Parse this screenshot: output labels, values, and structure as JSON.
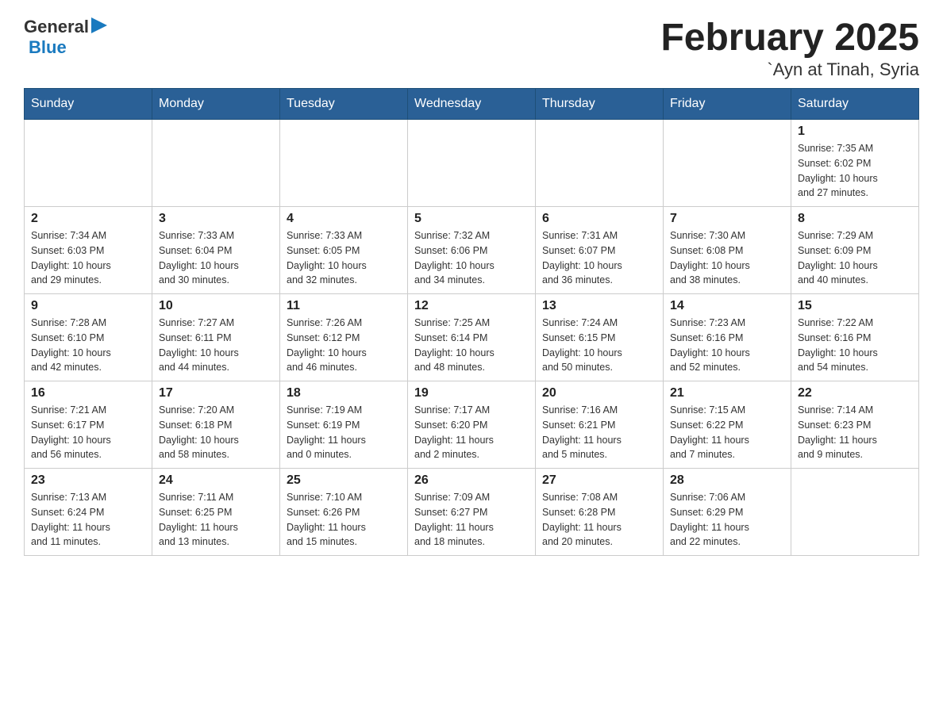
{
  "header": {
    "logo_general": "General",
    "logo_blue": "Blue",
    "month_title": "February 2025",
    "location": "`Ayn at Tinah, Syria"
  },
  "days_of_week": [
    "Sunday",
    "Monday",
    "Tuesday",
    "Wednesday",
    "Thursday",
    "Friday",
    "Saturday"
  ],
  "weeks": [
    {
      "days": [
        {
          "number": "",
          "info": ""
        },
        {
          "number": "",
          "info": ""
        },
        {
          "number": "",
          "info": ""
        },
        {
          "number": "",
          "info": ""
        },
        {
          "number": "",
          "info": ""
        },
        {
          "number": "",
          "info": ""
        },
        {
          "number": "1",
          "info": "Sunrise: 7:35 AM\nSunset: 6:02 PM\nDaylight: 10 hours\nand 27 minutes."
        }
      ]
    },
    {
      "days": [
        {
          "number": "2",
          "info": "Sunrise: 7:34 AM\nSunset: 6:03 PM\nDaylight: 10 hours\nand 29 minutes."
        },
        {
          "number": "3",
          "info": "Sunrise: 7:33 AM\nSunset: 6:04 PM\nDaylight: 10 hours\nand 30 minutes."
        },
        {
          "number": "4",
          "info": "Sunrise: 7:33 AM\nSunset: 6:05 PM\nDaylight: 10 hours\nand 32 minutes."
        },
        {
          "number": "5",
          "info": "Sunrise: 7:32 AM\nSunset: 6:06 PM\nDaylight: 10 hours\nand 34 minutes."
        },
        {
          "number": "6",
          "info": "Sunrise: 7:31 AM\nSunset: 6:07 PM\nDaylight: 10 hours\nand 36 minutes."
        },
        {
          "number": "7",
          "info": "Sunrise: 7:30 AM\nSunset: 6:08 PM\nDaylight: 10 hours\nand 38 minutes."
        },
        {
          "number": "8",
          "info": "Sunrise: 7:29 AM\nSunset: 6:09 PM\nDaylight: 10 hours\nand 40 minutes."
        }
      ]
    },
    {
      "days": [
        {
          "number": "9",
          "info": "Sunrise: 7:28 AM\nSunset: 6:10 PM\nDaylight: 10 hours\nand 42 minutes."
        },
        {
          "number": "10",
          "info": "Sunrise: 7:27 AM\nSunset: 6:11 PM\nDaylight: 10 hours\nand 44 minutes."
        },
        {
          "number": "11",
          "info": "Sunrise: 7:26 AM\nSunset: 6:12 PM\nDaylight: 10 hours\nand 46 minutes."
        },
        {
          "number": "12",
          "info": "Sunrise: 7:25 AM\nSunset: 6:14 PM\nDaylight: 10 hours\nand 48 minutes."
        },
        {
          "number": "13",
          "info": "Sunrise: 7:24 AM\nSunset: 6:15 PM\nDaylight: 10 hours\nand 50 minutes."
        },
        {
          "number": "14",
          "info": "Sunrise: 7:23 AM\nSunset: 6:16 PM\nDaylight: 10 hours\nand 52 minutes."
        },
        {
          "number": "15",
          "info": "Sunrise: 7:22 AM\nSunset: 6:16 PM\nDaylight: 10 hours\nand 54 minutes."
        }
      ]
    },
    {
      "days": [
        {
          "number": "16",
          "info": "Sunrise: 7:21 AM\nSunset: 6:17 PM\nDaylight: 10 hours\nand 56 minutes."
        },
        {
          "number": "17",
          "info": "Sunrise: 7:20 AM\nSunset: 6:18 PM\nDaylight: 10 hours\nand 58 minutes."
        },
        {
          "number": "18",
          "info": "Sunrise: 7:19 AM\nSunset: 6:19 PM\nDaylight: 11 hours\nand 0 minutes."
        },
        {
          "number": "19",
          "info": "Sunrise: 7:17 AM\nSunset: 6:20 PM\nDaylight: 11 hours\nand 2 minutes."
        },
        {
          "number": "20",
          "info": "Sunrise: 7:16 AM\nSunset: 6:21 PM\nDaylight: 11 hours\nand 5 minutes."
        },
        {
          "number": "21",
          "info": "Sunrise: 7:15 AM\nSunset: 6:22 PM\nDaylight: 11 hours\nand 7 minutes."
        },
        {
          "number": "22",
          "info": "Sunrise: 7:14 AM\nSunset: 6:23 PM\nDaylight: 11 hours\nand 9 minutes."
        }
      ]
    },
    {
      "days": [
        {
          "number": "23",
          "info": "Sunrise: 7:13 AM\nSunset: 6:24 PM\nDaylight: 11 hours\nand 11 minutes."
        },
        {
          "number": "24",
          "info": "Sunrise: 7:11 AM\nSunset: 6:25 PM\nDaylight: 11 hours\nand 13 minutes."
        },
        {
          "number": "25",
          "info": "Sunrise: 7:10 AM\nSunset: 6:26 PM\nDaylight: 11 hours\nand 15 minutes."
        },
        {
          "number": "26",
          "info": "Sunrise: 7:09 AM\nSunset: 6:27 PM\nDaylight: 11 hours\nand 18 minutes."
        },
        {
          "number": "27",
          "info": "Sunrise: 7:08 AM\nSunset: 6:28 PM\nDaylight: 11 hours\nand 20 minutes."
        },
        {
          "number": "28",
          "info": "Sunrise: 7:06 AM\nSunset: 6:29 PM\nDaylight: 11 hours\nand 22 minutes."
        },
        {
          "number": "",
          "info": ""
        }
      ]
    }
  ]
}
